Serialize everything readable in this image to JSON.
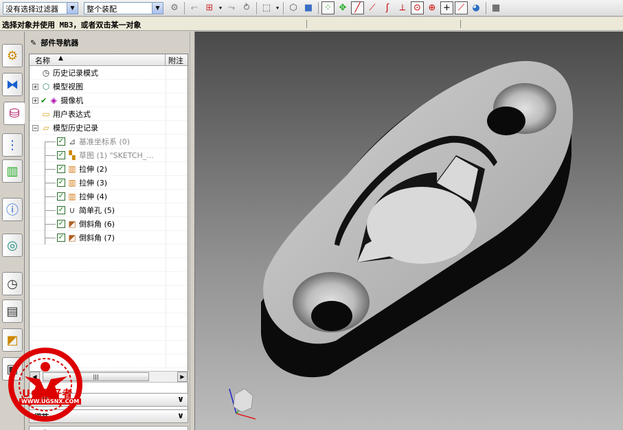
{
  "toolbar": {
    "filter_value": "没有选择过滤器",
    "scope_value": "整个装配",
    "icons": [
      "type-filter-icon",
      "snap-point-icon",
      "point-constructor-icon",
      "select-options-icon",
      "snap-dropdown-icon",
      "rectangle-select-icon",
      "view-cube-icon",
      "shaded-view-icon",
      "existing-point-icon",
      "end-point-icon",
      "line-icon",
      "line-end-icon",
      "curve-icon",
      "perpendicular-icon",
      "arc-center-icon",
      "circle-icon",
      "intersection-icon",
      "midpoint-icon",
      "quadrant-icon",
      "graphics-window-icon"
    ]
  },
  "cue": {
    "text": "选择对象并使用 MB3，或者双击某一对象"
  },
  "navigator": {
    "title": "部件导航器",
    "columns": {
      "name": "名称",
      "note": "附注"
    },
    "nodes": [
      {
        "label": "历史记录模式",
        "icon": "clock-icon",
        "level": 0
      },
      {
        "label": "模型视图",
        "icon": "model-view-icon",
        "level": 0,
        "expander": "+"
      },
      {
        "label": "摄像机",
        "icon": "camera-icon",
        "level": 0,
        "expander": "+",
        "checked": true
      },
      {
        "label": "用户表达式",
        "icon": "folder-icon",
        "level": 0
      },
      {
        "label": "模型历史记录",
        "icon": "folder-open-icon",
        "level": 0,
        "expander": "−"
      },
      {
        "label": "基准坐标系 (0)",
        "icon": "datum-csys-icon",
        "level": 1,
        "checked": true,
        "greyed": true
      },
      {
        "label": "草图 (1) \"SKETCH_...",
        "icon": "sketch-icon",
        "level": 1,
        "checked": true,
        "greyed": true
      },
      {
        "label": "拉伸 (2)",
        "icon": "extrude-icon",
        "level": 1,
        "checked": true
      },
      {
        "label": "拉伸 (3)",
        "icon": "extrude-icon",
        "level": 1,
        "checked": true
      },
      {
        "label": "拉伸 (4)",
        "icon": "extrude-icon",
        "level": 1,
        "checked": true
      },
      {
        "label": "简单孔 (5)",
        "icon": "hole-icon",
        "level": 1,
        "checked": true
      },
      {
        "label": "倒斜角 (6)",
        "icon": "chamfer-icon",
        "level": 1,
        "checked": true
      },
      {
        "label": "倒斜角 (7)",
        "icon": "chamfer-icon",
        "level": 1,
        "checked": true
      }
    ],
    "panels": [
      {
        "label": "相依性"
      },
      {
        "label": "细节"
      },
      {
        "label": "预览"
      }
    ]
  },
  "resource_bar": {
    "tabs": [
      "assembly-navigator-icon",
      "constraint-navigator-icon",
      "part-navigator-icon",
      "reuse-library-icon",
      "palette-icon",
      "info-icon",
      "web-icon",
      "history-icon",
      "process-studio-icon",
      "roles-icon",
      "system-scene-icon"
    ]
  },
  "watermark": {
    "line1": "UG爱好者",
    "line2": "WWW.UGSNX.COM"
  },
  "colors": {
    "background": "#d4d0c8",
    "check": "#0a8a0a",
    "viewport_top": "#4a4a4a",
    "viewport_bottom": "#bdbdbd",
    "watermark": "#dd0000"
  }
}
